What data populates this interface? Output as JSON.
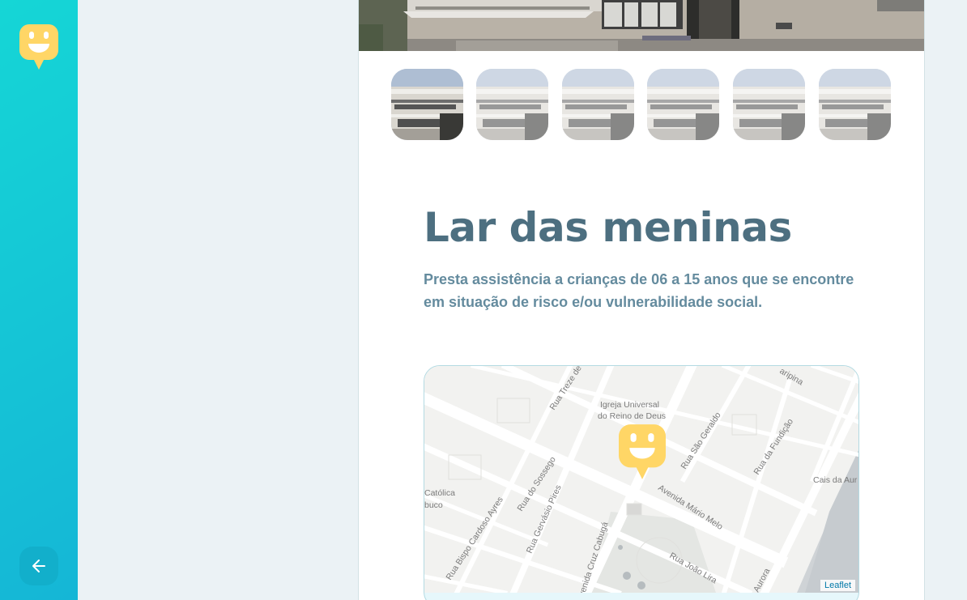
{
  "sidebar": {
    "logo_icon": "smiley-marker-icon",
    "back_icon": "arrow-left-icon",
    "gradient": [
      "#15b6d6",
      "#15d6d6"
    ],
    "back_button_color": "#12afcb"
  },
  "orphanage": {
    "name": "Lar das meninas",
    "about": "Presta assistência a crianças de 06 a 15 anos que se encontre em situação de risco e/ou vulnerabilidade social.",
    "thumbnail_count": 6,
    "active_thumbnail": 1
  },
  "map": {
    "attribution": "Leaflet",
    "labels": {
      "church": "Igreja Universal",
      "church2": "do Reino de Deus",
      "rua_treze": "Rua Treze de",
      "rua_sao_geraldo": "Rua São Geraldo",
      "rua_fundicao": "Rua da Fundição",
      "caripina": "aripina",
      "cais": "Cais da Aur",
      "catolica": "Católica",
      "buco": "buco",
      "rua_sossego": "Rua do Sossego",
      "rua_bispo": "Rua Bispo Cardoso Ayres",
      "rua_gervasio": "Rua Gervásio Pires",
      "av_cruz": "venida Cruz Cabugá",
      "av_mario": "Avenida Mário Melo",
      "rua_joao": "Rua João Lira",
      "aurora": "Aurora"
    },
    "marker_icon": "smiley-marker-icon",
    "marker_color": "#ffd666"
  },
  "colors": {
    "title": "#4d6f80",
    "text": "#5c8599",
    "background": "#ebf2f5"
  }
}
